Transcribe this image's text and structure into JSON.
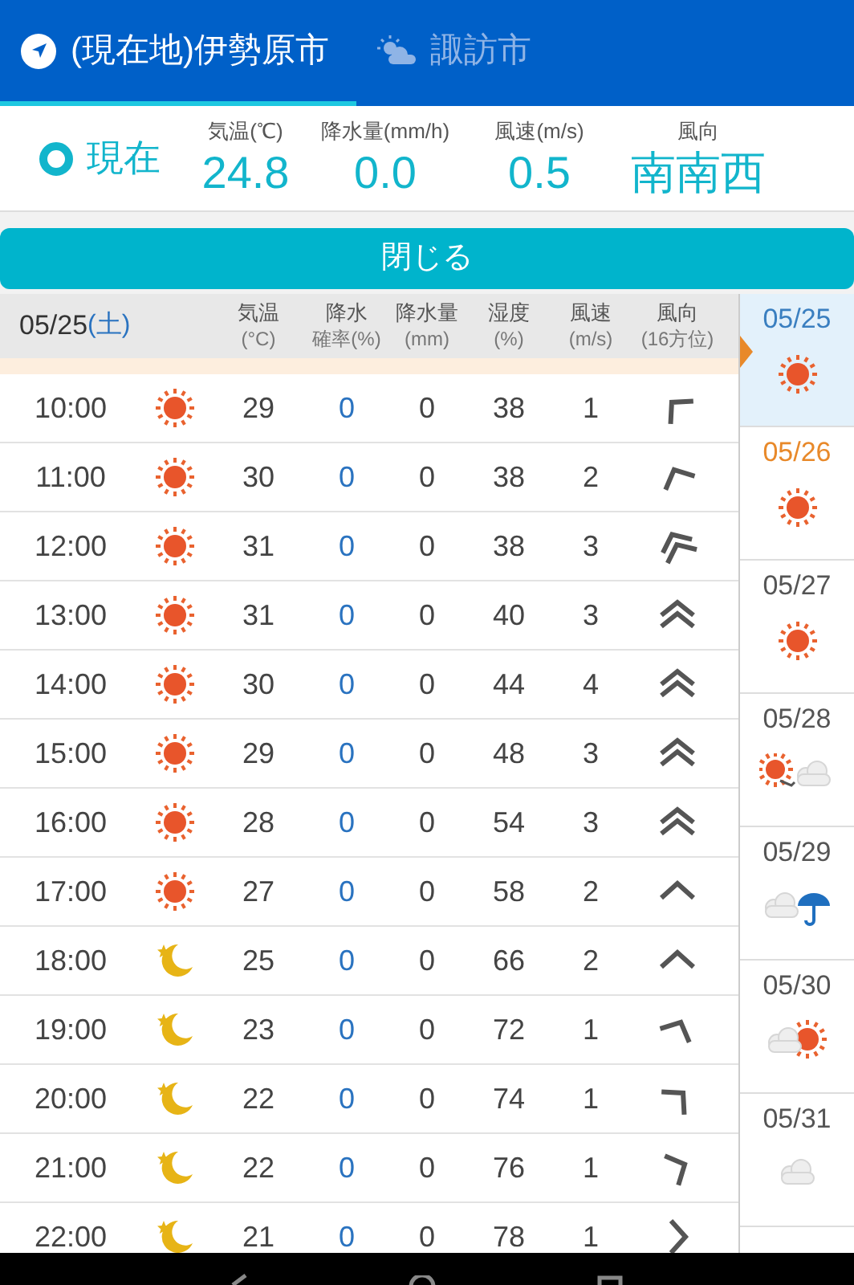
{
  "tabs": [
    {
      "label": "(現在地)伊勢原市",
      "selected": true
    },
    {
      "label": "諏訪市",
      "selected": false
    }
  ],
  "current": {
    "title": "現在",
    "readings": [
      {
        "label": "気温(℃)",
        "value": "24.8"
      },
      {
        "label": "降水量(mm/h)",
        "value": "0.0"
      },
      {
        "label": "風速(m/s)",
        "value": "0.5"
      },
      {
        "label": "風向",
        "value": "南南西"
      }
    ]
  },
  "close_button": "閉じる",
  "table": {
    "date": "05/25",
    "weekday": "(土)",
    "columns": [
      {
        "top": "気温",
        "bottom": "(°C)"
      },
      {
        "top": "降水",
        "bottom": "確率(%)"
      },
      {
        "top": "降水量",
        "bottom": "(mm)"
      },
      {
        "top": "湿度",
        "bottom": "(%)"
      },
      {
        "top": "風速",
        "bottom": "(m/s)"
      },
      {
        "top": "風向",
        "bottom": "(16方位)"
      }
    ],
    "rows": [
      {
        "time": "10:00",
        "kind": "sun",
        "temp": "29",
        "prob": "0",
        "precip": "0",
        "humidity": "38",
        "speed": "1",
        "wind": {
          "kind": "single_nw"
        }
      },
      {
        "time": "11:00",
        "kind": "sun",
        "temp": "30",
        "prob": "0",
        "precip": "0",
        "humidity": "38",
        "speed": "2",
        "wind": {
          "kind": "single_nnw"
        }
      },
      {
        "time": "12:00",
        "kind": "sun",
        "temp": "31",
        "prob": "0",
        "precip": "0",
        "humidity": "38",
        "speed": "3",
        "wind": {
          "kind": "double_nnw"
        }
      },
      {
        "time": "13:00",
        "kind": "sun",
        "temp": "31",
        "prob": "0",
        "precip": "0",
        "humidity": "40",
        "speed": "3",
        "wind": {
          "kind": "double_n"
        }
      },
      {
        "time": "14:00",
        "kind": "sun",
        "temp": "30",
        "prob": "0",
        "precip": "0",
        "humidity": "44",
        "speed": "4",
        "wind": {
          "kind": "double_n"
        }
      },
      {
        "time": "15:00",
        "kind": "sun",
        "temp": "29",
        "prob": "0",
        "precip": "0",
        "humidity": "48",
        "speed": "3",
        "wind": {
          "kind": "double_n"
        }
      },
      {
        "time": "16:00",
        "kind": "sun",
        "temp": "28",
        "prob": "0",
        "precip": "0",
        "humidity": "54",
        "speed": "3",
        "wind": {
          "kind": "double_n"
        }
      },
      {
        "time": "17:00",
        "kind": "sun",
        "temp": "27",
        "prob": "0",
        "precip": "0",
        "humidity": "58",
        "speed": "2",
        "wind": {
          "kind": "single_n"
        }
      },
      {
        "time": "18:00",
        "kind": "moon",
        "temp": "25",
        "prob": "0",
        "precip": "0",
        "humidity": "66",
        "speed": "2",
        "wind": {
          "kind": "single_n"
        }
      },
      {
        "time": "19:00",
        "kind": "moon",
        "temp": "23",
        "prob": "0",
        "precip": "0",
        "humidity": "72",
        "speed": "1",
        "wind": {
          "kind": "single_nne"
        }
      },
      {
        "time": "20:00",
        "kind": "moon",
        "temp": "22",
        "prob": "0",
        "precip": "0",
        "humidity": "74",
        "speed": "1",
        "wind": {
          "kind": "single_ne"
        }
      },
      {
        "time": "21:00",
        "kind": "moon",
        "temp": "22",
        "prob": "0",
        "precip": "0",
        "humidity": "76",
        "speed": "1",
        "wind": {
          "kind": "single_ene"
        }
      },
      {
        "time": "22:00",
        "kind": "moon",
        "temp": "21",
        "prob": "0",
        "precip": "0",
        "humidity": "78",
        "speed": "1",
        "wind": {
          "kind": "single_e"
        }
      }
    ]
  },
  "days": [
    {
      "date": "05/25",
      "kind": "sun",
      "color": "#3a7fc0",
      "selected": true
    },
    {
      "date": "05/26",
      "kind": "sun",
      "color": "#e8892a",
      "selected": false
    },
    {
      "date": "05/27",
      "kind": "sun",
      "color": "#555555",
      "selected": false
    },
    {
      "date": "05/28",
      "kind": "sun_to_cloud",
      "color": "#555555",
      "selected": false
    },
    {
      "date": "05/29",
      "kind": "cloud_rain",
      "color": "#555555",
      "selected": false
    },
    {
      "date": "05/30",
      "kind": "cloud_sun",
      "color": "#555555",
      "selected": false
    },
    {
      "date": "05/31",
      "kind": "cloud",
      "color": "#555555",
      "selected": false
    }
  ]
}
